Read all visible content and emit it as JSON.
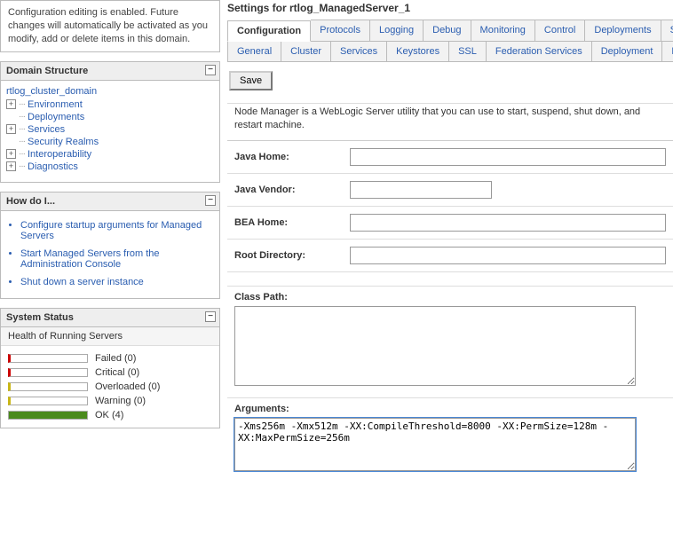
{
  "info_panel": "Configuration editing is enabled. Future changes will automatically be activated as you modify, add or delete items in this domain.",
  "domain_structure": {
    "title": "Domain Structure",
    "root": "rtlog_cluster_domain",
    "nodes": [
      {
        "label": "Environment",
        "expandable": true
      },
      {
        "label": "Deployments",
        "expandable": false
      },
      {
        "label": "Services",
        "expandable": true
      },
      {
        "label": "Security Realms",
        "expandable": false
      },
      {
        "label": "Interoperability",
        "expandable": true
      },
      {
        "label": "Diagnostics",
        "expandable": true
      }
    ]
  },
  "howdo": {
    "title": "How do I...",
    "items": [
      "Configure startup arguments for Managed Servers",
      "Start Managed Servers from the Administration Console",
      "Shut down a server instance"
    ]
  },
  "status": {
    "title": "System Status",
    "subtitle": "Health of Running Servers",
    "rows": [
      {
        "label": "Failed (0)",
        "cls": "failed"
      },
      {
        "label": "Critical (0)",
        "cls": "critical"
      },
      {
        "label": "Overloaded (0)",
        "cls": "overloaded"
      },
      {
        "label": "Warning (0)",
        "cls": "warning"
      },
      {
        "label": "OK (4)",
        "cls": "ok"
      }
    ]
  },
  "settings": {
    "title": "Settings for rtlog_ManagedServer_1",
    "tabs": [
      "Configuration",
      "Protocols",
      "Logging",
      "Debug",
      "Monitoring",
      "Control",
      "Deployments",
      "Serv"
    ],
    "subtabs": [
      "General",
      "Cluster",
      "Services",
      "Keystores",
      "SSL",
      "Federation Services",
      "Deployment",
      "Migra"
    ],
    "save": "Save",
    "desc": "Node Manager is a WebLogic Server utility that you can use to start, suspend, shut down, and restart machine.",
    "fields": {
      "java_home": {
        "label": "Java Home:",
        "value": ""
      },
      "java_vendor": {
        "label": "Java Vendor:",
        "value": ""
      },
      "bea_home": {
        "label": "BEA Home:",
        "value": ""
      },
      "root_dir": {
        "label": "Root Directory:",
        "value": ""
      },
      "class_path": {
        "label": "Class Path:",
        "value": ""
      },
      "arguments": {
        "label": "Arguments:",
        "value": "-Xms256m -Xmx512m -XX:CompileThreshold=8000 -XX:PermSize=128m -XX:MaxPermSize=256m"
      }
    }
  }
}
